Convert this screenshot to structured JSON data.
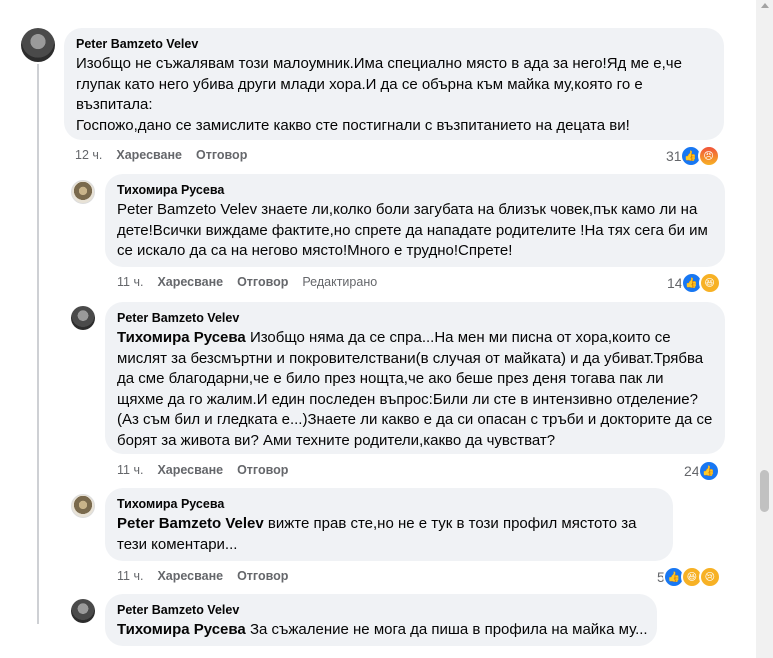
{
  "comments": [
    {
      "author": "Peter Bamzeto Velev",
      "mention": "",
      "text": "Изобщо не съжалявам този малоумник.Има специално място в ада за него!Яд ме е,че глупак като него убива други млади хора.И да се обърна към майка му,която го е възпитала:",
      "text2": "Госпожо,дано се замислите какво сте постигнали с възпитанието на децата ви!",
      "time": "12 ч.",
      "like": "Харесване",
      "reply": "Отговор",
      "edited": "",
      "reactions_count": "31",
      "reactions": [
        "like-icon",
        "angry-icon"
      ]
    },
    {
      "author": "Тихомира Русева",
      "mention": "",
      "text": "Peter Bamzeto Velev знаете ли,колко боли загубата на близък човек,пък камо ли на дете!Всички виждаме фактите,но спрете да нападате родителите !На тях сега би им се искало да са на негово място!Много е трудно!Спрете!",
      "time": "11 ч.",
      "like": "Харесване",
      "reply": "Отговор",
      "edited": "Редактирано",
      "reactions_count": "14",
      "reactions": [
        "like-icon",
        "haha-icon"
      ]
    },
    {
      "author": "Peter Bamzeto Velev",
      "mention": "Тихомира Русева",
      "text": "Изобщо няма да се спра...На мен ми писна от хора,които се мислят за безсмъртни и покровителствани(в случая от майката) и да убиват.Трябва да сме благодарни,че е било през нощта,че ако беше през деня тогава пак ли щяхме да го жалим.И един последен въпрос:Били ли сте в интензивно отделение?(Аз съм бил и гледката е...)Знаете ли какво е да си опасан с тръби и докторите да се борят за живота ви? Ами техните родители,какво да чувстват?",
      "time": "11 ч.",
      "like": "Харесване",
      "reply": "Отговор",
      "edited": "",
      "reactions_count": "24",
      "reactions": [
        "like-icon"
      ]
    },
    {
      "author": "Тихомира Русева",
      "mention": "Peter Bamzeto Velev",
      "text": "вижте прав сте,но не е тук в този профил мястото за тези коментари...",
      "time": "11 ч.",
      "like": "Харесване",
      "reply": "Отговор",
      "edited": "",
      "reactions_count": "5",
      "reactions": [
        "like-icon",
        "haha-icon",
        "sad-icon"
      ]
    },
    {
      "author": "Peter Bamzeto Velev",
      "mention": "Тихомира Русева",
      "text": "За съжаление не мога да пиша в профила на майка му...",
      "time": "",
      "like": "",
      "reply": "",
      "edited": "",
      "reactions_count": "",
      "reactions": []
    }
  ]
}
